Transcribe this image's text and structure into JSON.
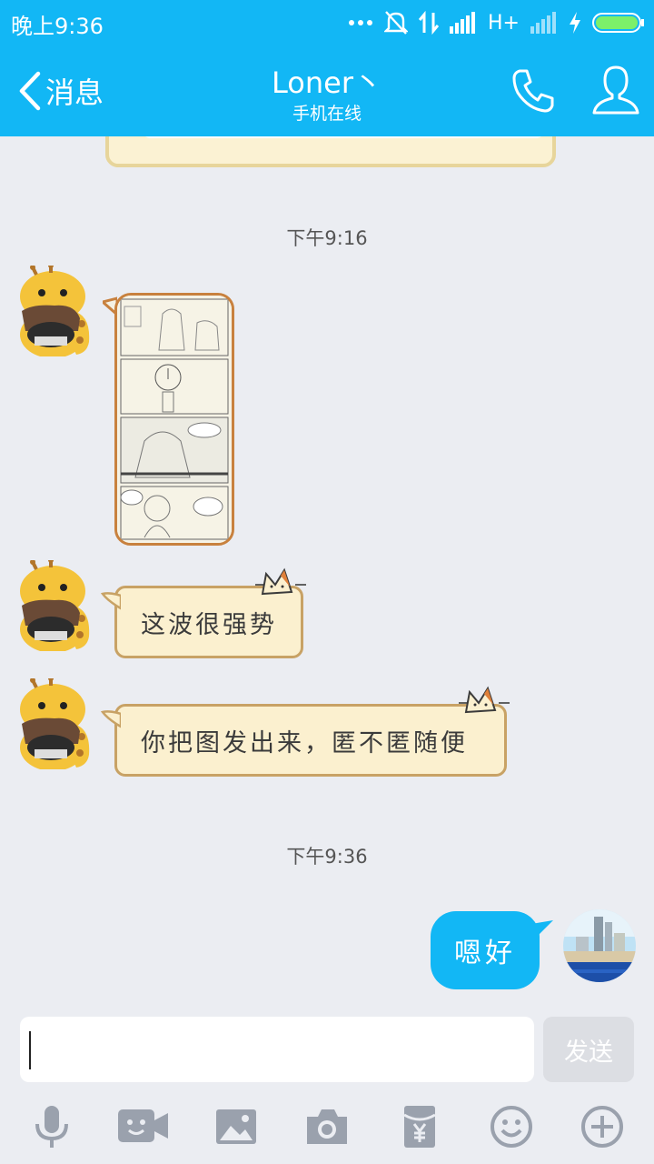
{
  "status_bar": {
    "time": "晚上9:36",
    "network_label": "H+"
  },
  "header": {
    "back_label": "消息",
    "contact_name": "Loner丶",
    "contact_status": "手机在线"
  },
  "messages": [
    {
      "type": "timestamp",
      "text": "下午9:16"
    },
    {
      "type": "image",
      "from": "contact"
    },
    {
      "type": "text",
      "from": "contact",
      "text": "这波很强势"
    },
    {
      "type": "text",
      "from": "contact",
      "text": "你把图发出来，匿不匿随便"
    },
    {
      "type": "timestamp",
      "text": "下午9:36"
    },
    {
      "type": "text",
      "from": "me",
      "text": "嗯好"
    }
  ],
  "composer": {
    "input_value": "",
    "send_label": "发送"
  },
  "toolbar": {
    "icons": [
      "microphone-icon",
      "video-call-icon",
      "image-icon",
      "camera-icon",
      "red-packet-icon",
      "emoji-icon",
      "plus-icon"
    ]
  },
  "colors": {
    "header_bg": "#12b7f5",
    "chat_bg": "#ebedf2",
    "my_bubble": "#12b7f5",
    "contact_bubble": "#fbf0cf"
  }
}
